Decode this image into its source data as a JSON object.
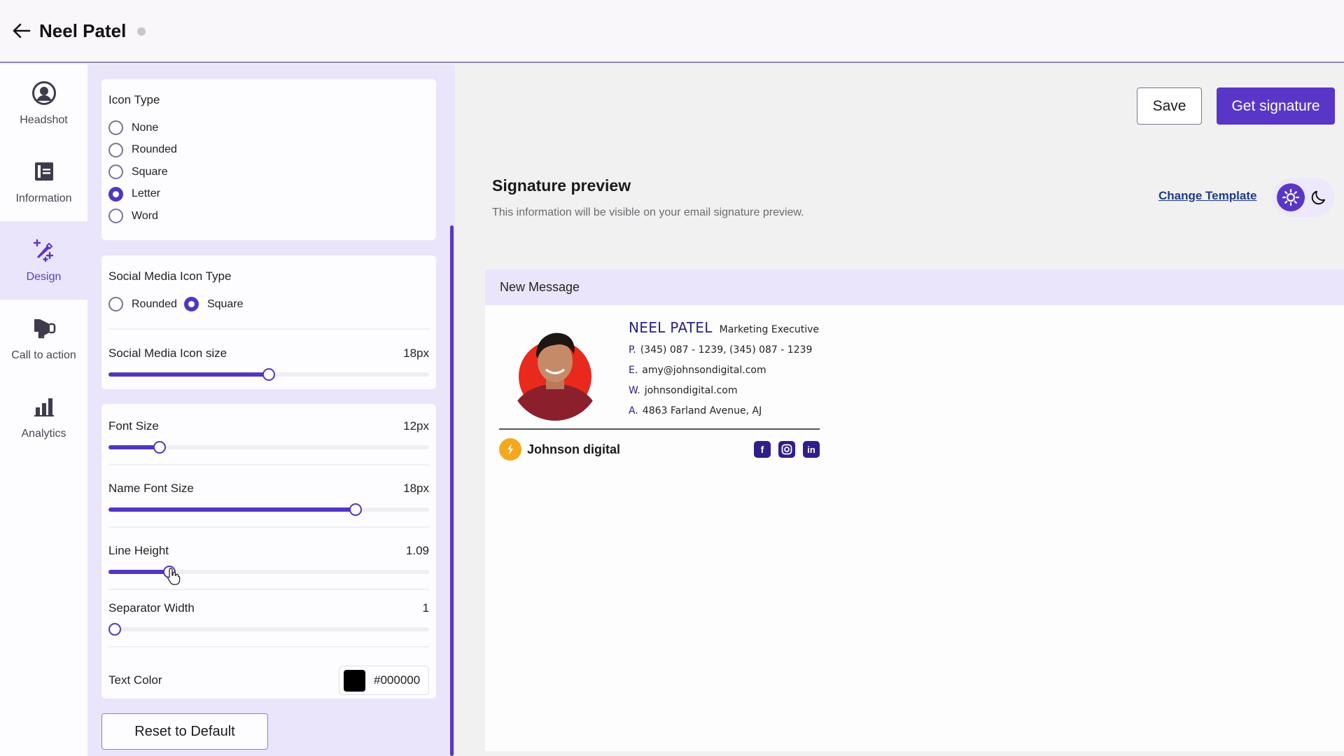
{
  "header": {
    "title": "Neel Patel",
    "back_icon": "arrow-left-icon",
    "status_icon": "status-dot"
  },
  "sidebar": {
    "items": [
      {
        "label": "Headshot",
        "icon": "user-circle-icon",
        "active": false
      },
      {
        "label": "Information",
        "icon": "info-card-icon",
        "active": false
      },
      {
        "label": "Design",
        "icon": "magic-wand-icon",
        "active": true
      },
      {
        "label": "Call to action",
        "icon": "megaphone-icon",
        "active": false
      },
      {
        "label": "Analytics",
        "icon": "bar-chart-icon",
        "active": false
      }
    ]
  },
  "settings": {
    "icon_type": {
      "title": "Icon Type",
      "options": [
        "None",
        "Rounded",
        "Square",
        "Letter",
        "Word"
      ],
      "selected": "Letter"
    },
    "social_icon_type": {
      "title": "Social Media Icon Type",
      "options": [
        "Rounded",
        "Square"
      ],
      "selected": "Square"
    },
    "social_icon_size": {
      "label": "Social Media Icon size",
      "value": "18px",
      "fraction": 0.5
    },
    "font_size": {
      "label": "Font Size",
      "value": "12px",
      "fraction": 0.16
    },
    "name_font_size": {
      "label": "Name Font Size",
      "value": "18px",
      "fraction": 0.77
    },
    "line_height": {
      "label": "Line Height",
      "value": "1.09",
      "fraction": 0.19
    },
    "separator_width": {
      "label": "Separator Width",
      "value": "1",
      "fraction": 0.02
    },
    "text_color": {
      "label": "Text Color",
      "value": "#000000"
    },
    "reset_label": "Reset to Default"
  },
  "toolbar": {
    "save_label": "Save",
    "get_signature_label": "Get signature"
  },
  "preview": {
    "title": "Signature preview",
    "subtitle": "This information will be visible on your email signature preview.",
    "change_template_label": "Change Template",
    "theme": {
      "light_icon": "sun-icon",
      "dark_icon": "moon-icon",
      "selected": "light"
    },
    "message_bar_title": "New Message",
    "signature": {
      "name": "NEEL PATEL",
      "job_title": "Marketing Executive",
      "phone_label": "P.",
      "phone": "(345) 087 - 1239, (345) 087 - 1239",
      "email_label": "E.",
      "email": "amy@johnsondigital.com",
      "website_label": "W.",
      "website": "johnsondigital.com",
      "address_label": "A.",
      "address": "4863 Farland Avenue, AJ",
      "company": "Johnson digital",
      "socials": [
        "facebook",
        "instagram",
        "linkedin"
      ]
    }
  },
  "colors": {
    "accent": "#5a36c8",
    "accent_light": "#ebe5fb",
    "signature_name": "#2b2180",
    "company_logo": "#f3a81f"
  }
}
